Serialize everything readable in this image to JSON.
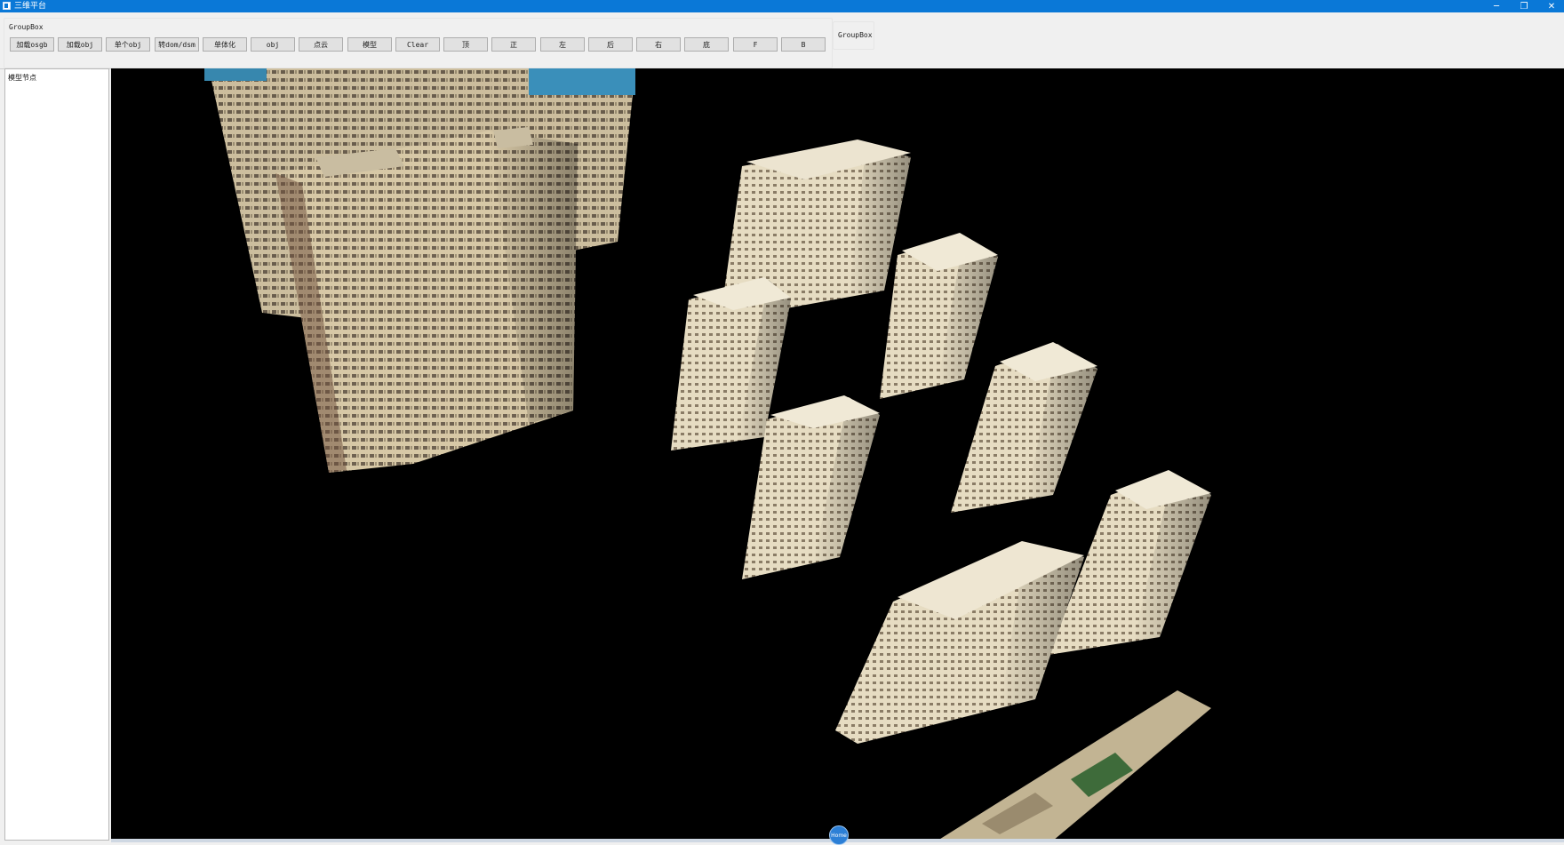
{
  "window": {
    "title": "三维平台",
    "controls": {
      "minimize": "─",
      "maximize": "❐",
      "close": "✕"
    }
  },
  "toolbar": {
    "group_title": "GroupBox",
    "buttons": [
      "加载osgb",
      "加载obj",
      "单个obj",
      "转dom/dsm",
      "单体化",
      "obj",
      "点云",
      "模型",
      "Clear",
      "顶",
      "正",
      "左",
      "后",
      "右",
      "底",
      "F",
      "B"
    ]
  },
  "group2": {
    "title": "GroupBox"
  },
  "tree": {
    "header": "模型节点"
  },
  "viewport": {
    "background": "#000000",
    "building_color": "#d8c9a8",
    "home_label": "Home"
  },
  "colors": {
    "titlebar": "#0a78d7",
    "toolbar_bg": "#f0f0f0"
  }
}
